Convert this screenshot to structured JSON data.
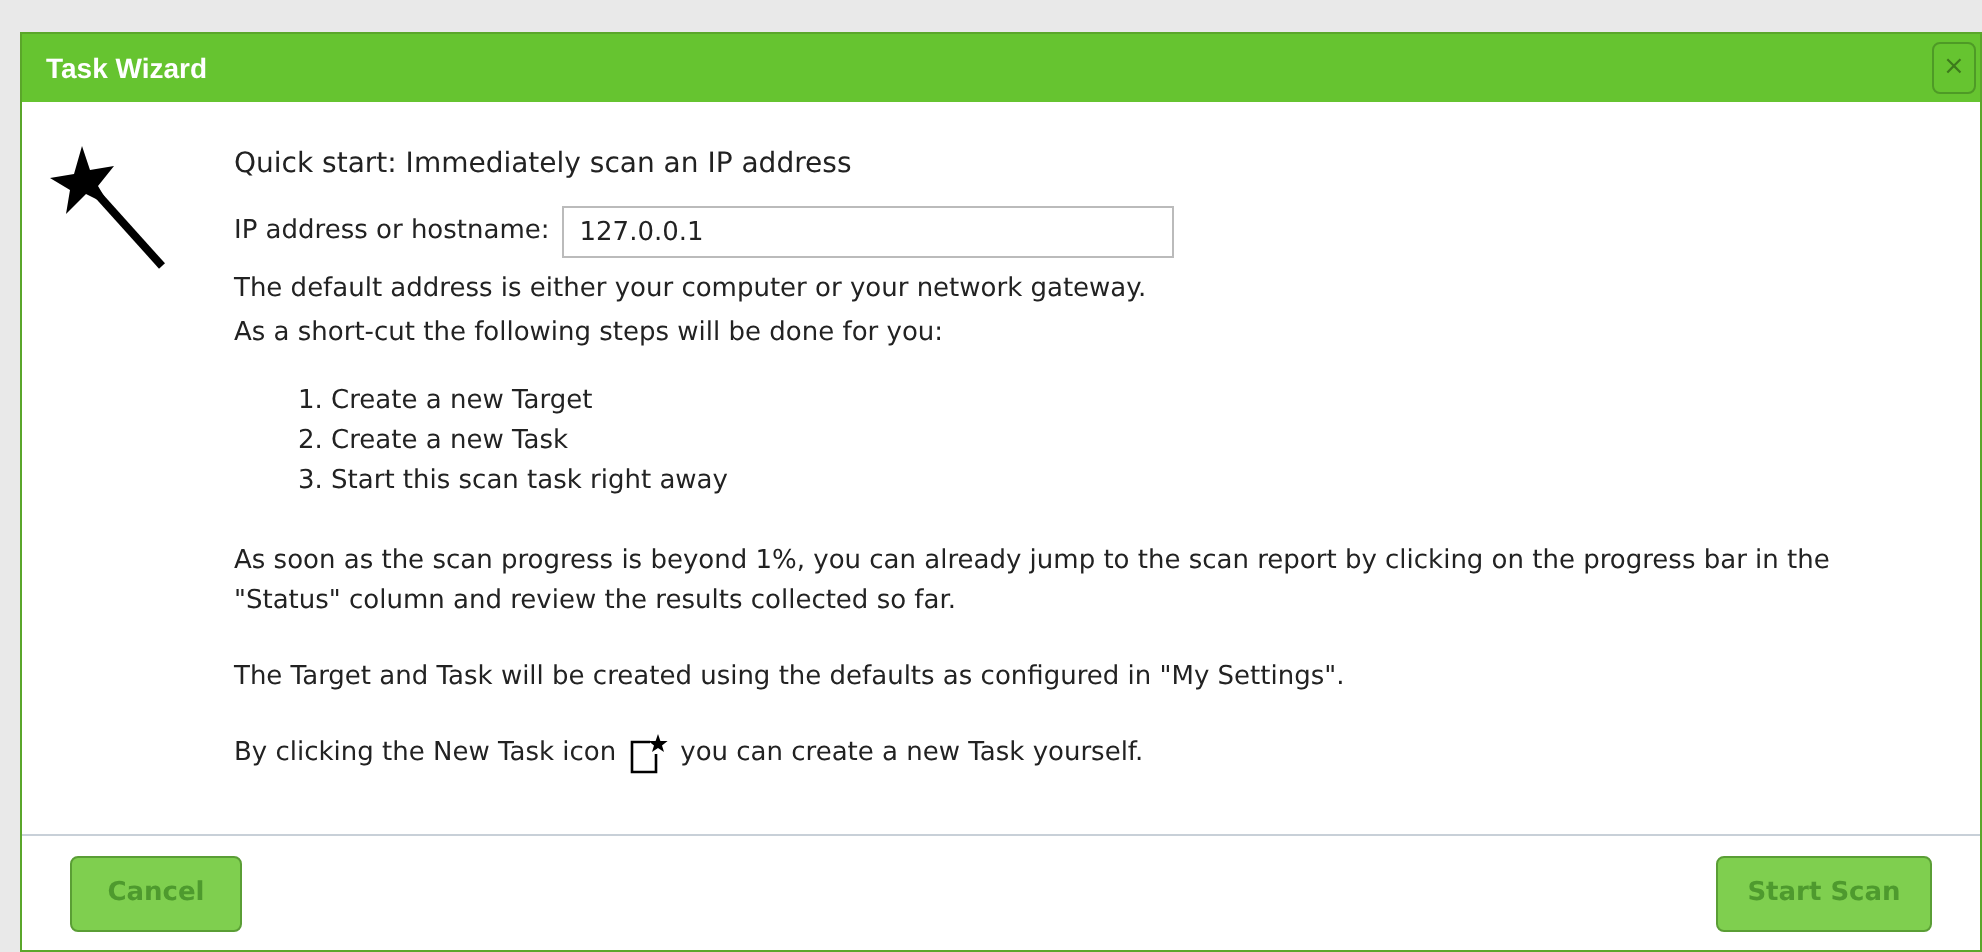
{
  "dialog": {
    "title": "Task Wizard",
    "close": "×"
  },
  "heading": "Quick start: Immediately scan an IP address",
  "host_field": {
    "label": "IP address or hostname:",
    "value": "127.0.0.1"
  },
  "notes": [
    "The default address is either your computer or your network gateway.",
    "As a short-cut the following steps will be done for you:"
  ],
  "steps": [
    "1. Create a new Target",
    "2. Create a new Task",
    "3. Start this scan task right away"
  ],
  "paragraphs": [
    "As soon as the scan progress is beyond 1%, you can already jump to the scan report by clicking on the progress bar in the \"Status\" column and review the results collected so far.",
    "The Target and Task will be created using the defaults as configured in \"My Settings\"."
  ],
  "new_task_hint": {
    "before": "By clicking the New Task icon",
    "after": "you can create a new Task yourself."
  },
  "buttons": {
    "cancel": "Cancel",
    "start": "Start Scan"
  }
}
